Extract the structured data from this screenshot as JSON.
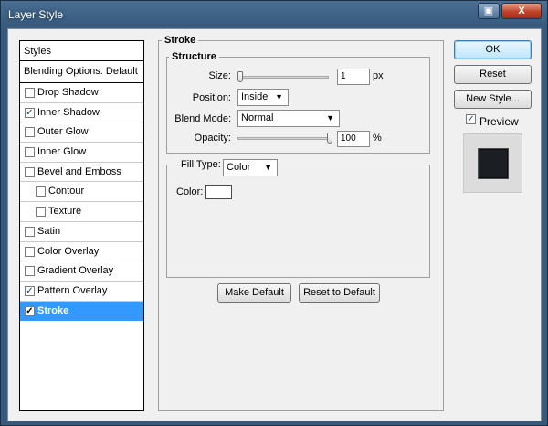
{
  "window": {
    "title": "Layer Style",
    "help_glyph": "▣",
    "close_glyph": "X"
  },
  "styles_panel": {
    "header": "Styles",
    "blending": "Blending Options: Default",
    "items": [
      {
        "label": "Drop Shadow",
        "checked": false,
        "sub": false,
        "selected": false
      },
      {
        "label": "Inner Shadow",
        "checked": true,
        "sub": false,
        "selected": false
      },
      {
        "label": "Outer Glow",
        "checked": false,
        "sub": false,
        "selected": false
      },
      {
        "label": "Inner Glow",
        "checked": false,
        "sub": false,
        "selected": false
      },
      {
        "label": "Bevel and Emboss",
        "checked": false,
        "sub": false,
        "selected": false
      },
      {
        "label": "Contour",
        "checked": false,
        "sub": true,
        "selected": false
      },
      {
        "label": "Texture",
        "checked": false,
        "sub": true,
        "selected": false
      },
      {
        "label": "Satin",
        "checked": false,
        "sub": false,
        "selected": false
      },
      {
        "label": "Color Overlay",
        "checked": false,
        "sub": false,
        "selected": false
      },
      {
        "label": "Gradient Overlay",
        "checked": false,
        "sub": false,
        "selected": false
      },
      {
        "label": "Pattern Overlay",
        "checked": true,
        "sub": false,
        "selected": false
      },
      {
        "label": "Stroke",
        "checked": true,
        "sub": false,
        "selected": true
      }
    ]
  },
  "stroke": {
    "title": "Stroke",
    "structure_title": "Structure",
    "size_label": "Size:",
    "size_value": "1",
    "size_unit": "px",
    "position_label": "Position:",
    "position_value": "Inside",
    "blend_mode_label": "Blend Mode:",
    "blend_mode_value": "Normal",
    "opacity_label": "Opacity:",
    "opacity_value": "100",
    "opacity_unit": "%",
    "fill_type_label": "Fill Type:",
    "fill_type_value": "Color",
    "color_label": "Color:",
    "stroke_color": "#ffffff",
    "make_default": "Make Default",
    "reset_default": "Reset to Default"
  },
  "buttons": {
    "ok": "OK",
    "reset": "Reset",
    "new_style": "New Style...",
    "preview_label": "Preview",
    "preview_checked": true
  },
  "checkmark": "✓",
  "dropdown_arrow": "▼"
}
